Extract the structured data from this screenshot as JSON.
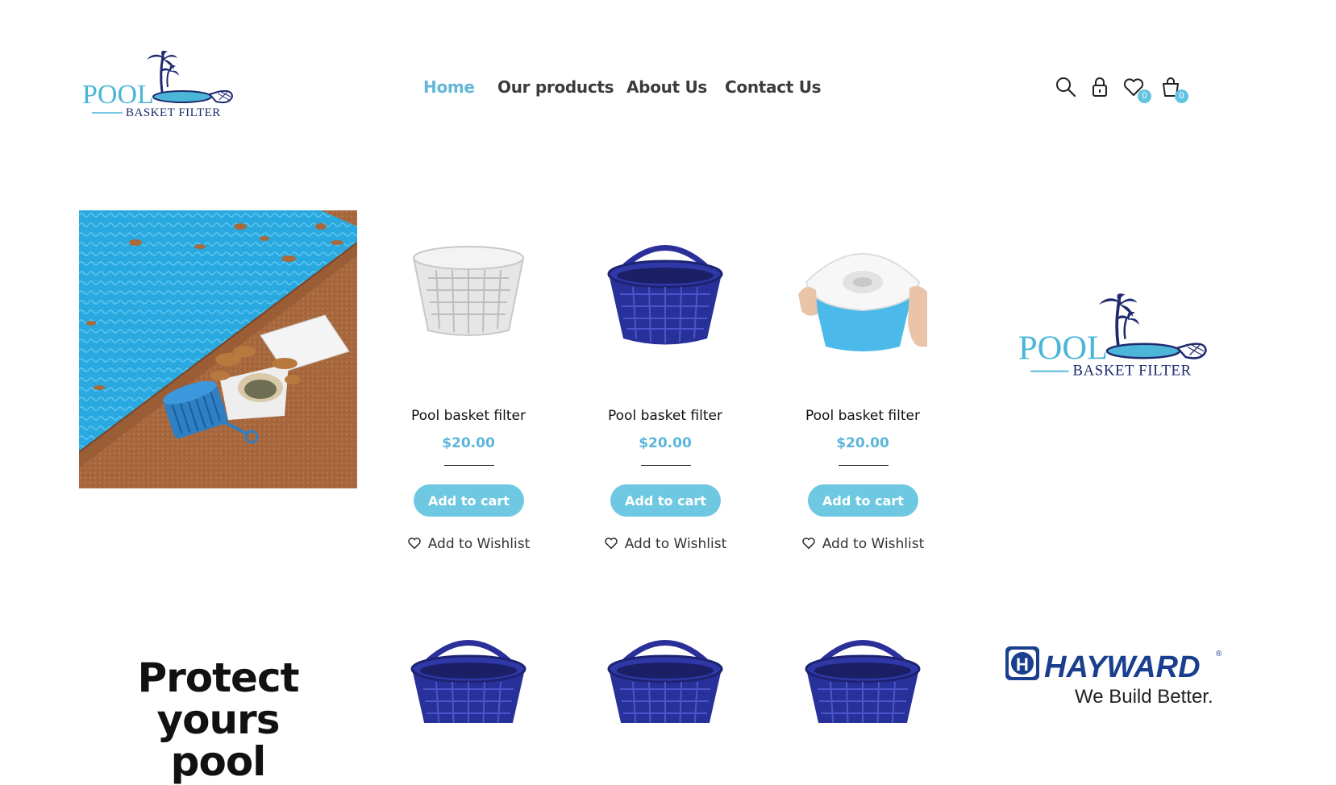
{
  "brand": {
    "word1": "POOL",
    "word2": "BASKET FILTER"
  },
  "nav": {
    "items": [
      {
        "label": "Home",
        "active": true
      },
      {
        "label": "Our products",
        "active": false
      },
      {
        "label": "About Us",
        "active": false
      },
      {
        "label": "Contact Us",
        "active": false
      }
    ]
  },
  "header_icons": {
    "search": "search-icon",
    "account": "lock-icon",
    "wishlist": {
      "icon": "heart-icon",
      "count": "0"
    },
    "cart": {
      "icon": "shopping-bag-icon",
      "count": "0"
    }
  },
  "products": [
    {
      "title": "Pool basket filter",
      "price": "$20.00",
      "cart_label": "Add to cart",
      "wishlist_label": "Add to Wishlist",
      "image": "white-basket"
    },
    {
      "title": "Pool basket filter",
      "price": "$20.00",
      "cart_label": "Add to cart",
      "wishlist_label": "Add to Wishlist",
      "image": "blue-basket"
    },
    {
      "title": "Pool basket filter",
      "price": "$20.00",
      "cart_label": "Add to cart",
      "wishlist_label": "Add to Wishlist",
      "image": "skimmer-sock"
    }
  ],
  "promo": {
    "heading_line1": "Protect yours",
    "heading_line2": "pool"
  },
  "partner": {
    "name": "HAYWARD",
    "tagline": "We Build Better.",
    "mark": "®"
  },
  "colors": {
    "accent": "#63b7d8",
    "button": "#6ec8e2",
    "logo_navy": "#1f2a6e",
    "logo_blue": "#4bb6d8"
  }
}
